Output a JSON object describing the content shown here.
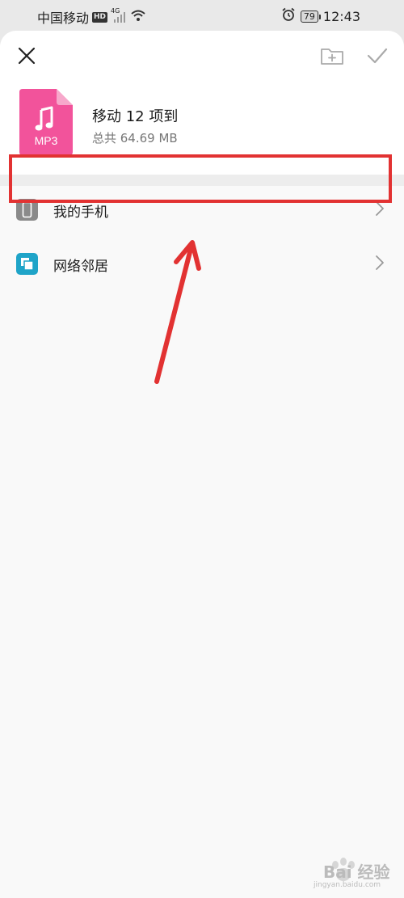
{
  "status_bar": {
    "carrier": "中国移动",
    "hd_badge": "HD",
    "network_type": "4G",
    "battery_level": "79",
    "time": "12:43"
  },
  "header": {
    "title": "移动 12 项到",
    "subtitle": "总共 64.69 MB",
    "file_type_label": "MP3",
    "file_icon_color": "#f2539b"
  },
  "locations": [
    {
      "label": "我的手机",
      "icon": "phone-icon",
      "icon_color": "#8a8a8a"
    },
    {
      "label": "网络邻居",
      "icon": "network-neighborhood-icon",
      "icon_color": "#1fa4c8"
    }
  ],
  "colors": {
    "highlight": "#e23232",
    "sheet_bg": "#f9f9f9",
    "header_bg": "#ffffff"
  },
  "watermark": {
    "brand": "Bai 经验",
    "url": "jingyan.baidu.com"
  }
}
